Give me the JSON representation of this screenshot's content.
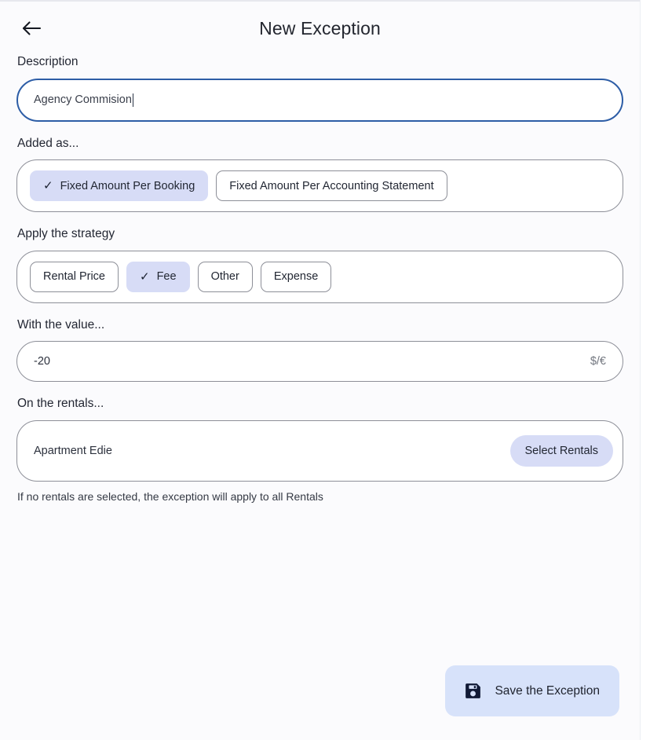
{
  "header": {
    "title": "New Exception",
    "back_icon": "arrow-left-icon"
  },
  "description": {
    "label": "Description",
    "value": "Agency Commision",
    "placeholder": "Description"
  },
  "added_as": {
    "label": "Added as...",
    "options": [
      {
        "label": "Fixed Amount Per Booking",
        "selected": true
      },
      {
        "label": "Fixed Amount Per Accounting Statement",
        "selected": false
      }
    ],
    "check_glyph": "✓"
  },
  "strategy": {
    "label": "Apply the strategy",
    "options": [
      {
        "label": "Rental Price",
        "selected": false
      },
      {
        "label": "Fee",
        "selected": true
      },
      {
        "label": "Other",
        "selected": false
      },
      {
        "label": "Expense",
        "selected": false
      }
    ],
    "check_glyph": "✓"
  },
  "value_field": {
    "label": "With the value...",
    "value": "-20",
    "suffix": "$/€"
  },
  "rentals": {
    "label": "On the rentals...",
    "selected_rental": "Apartment Edie",
    "select_button": "Select Rentals",
    "helper": "If no rentals are selected, the exception will apply to all Rentals"
  },
  "footer": {
    "save_label": "Save the Exception",
    "save_icon": "floppy-disk-save-icon"
  },
  "colors": {
    "page_bg": "#fbfbfd",
    "accent_chip": "#d7dcf6",
    "accent_button": "#d7e2fa",
    "focus_border": "#2d5da6",
    "icon_dark": "#111a35",
    "border_gray": "#8d8f98"
  }
}
